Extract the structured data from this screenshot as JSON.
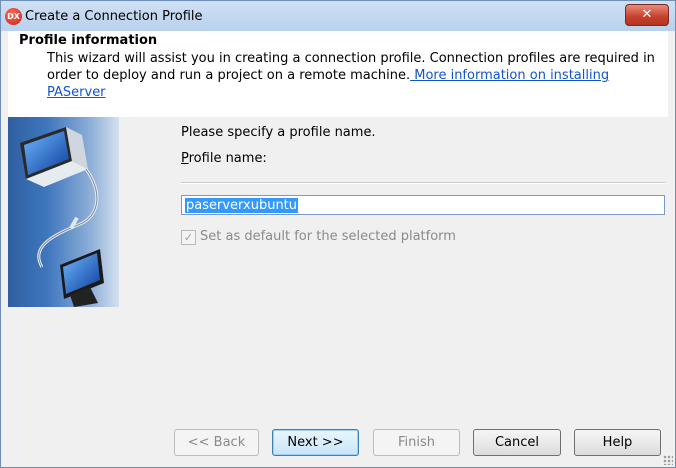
{
  "window": {
    "title": "Create a Connection Profile",
    "app_icon_text": "DX",
    "close_glyph": "✕"
  },
  "header": {
    "title": "Profile information",
    "description": "This wizard will assist you in creating a connection profile.  Connection profiles are required in order to deploy and run a project on a remote machine.",
    "link": " More information on installing PAServer"
  },
  "form": {
    "prompt": "Please specify a profile name.",
    "profile_label_accel": "P",
    "profile_label_rest": "rofile name:",
    "profile_name_value": "paserverxubuntu",
    "default_checkbox_label": "Set as default for the selected platform",
    "default_checkbox_checked": true
  },
  "buttons": {
    "back": "<< Back",
    "next": "Next >>",
    "finish": "Finish",
    "cancel": "Cancel",
    "help": "Help"
  },
  "icons": {
    "banner": "computer-network-illustration",
    "close": "close-icon"
  }
}
